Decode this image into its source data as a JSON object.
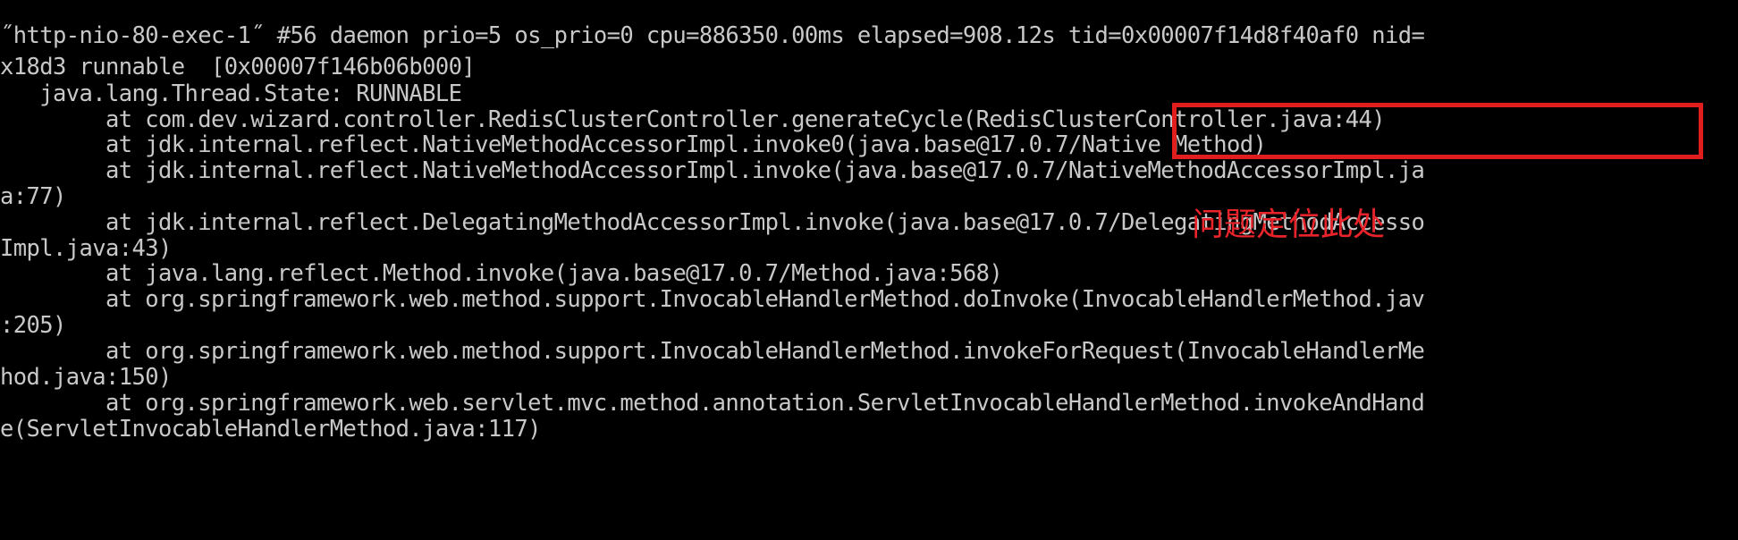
{
  "terminal": {
    "lines": [
      "˝http-nio-80-exec-1˝ #56 daemon prio=5 os_prio=0 cpu=886350.00ms elapsed=908.12s tid=0x00007f14d8f40af0 nid=",
      "x18d3 runnable  [0x00007f146b06b000]",
      "   java.lang.Thread.State: RUNNABLE",
      "        at com.dev.wizard.controller.RedisClusterController.generateCycle(RedisClusterController.java:44)",
      "        at jdk.internal.reflect.NativeMethodAccessorImpl.invoke0(java.base@17.0.7/Native Method)",
      "        at jdk.internal.reflect.NativeMethodAccessorImpl.invoke(java.base@17.0.7/NativeMethodAccessorImpl.ja",
      "a:77)",
      "        at jdk.internal.reflect.DelegatingMethodAccessorImpl.invoke(java.base@17.0.7/DelegatingMethodAccesso",
      "Impl.java:43)",
      "        at java.lang.reflect.Method.invoke(java.base@17.0.7/Method.java:568)",
      "        at org.springframework.web.method.support.InvocableHandlerMethod.doInvoke(InvocableHandlerMethod.jav",
      ":205)",
      "        at org.springframework.web.method.support.InvocableHandlerMethod.invokeForRequest(InvocableHandlerMe",
      "hod.java:150)",
      "        at org.springframework.web.servlet.mvc.method.annotation.ServletInvocableHandlerMethod.invokeAndHand",
      "e(ServletInvocableHandlerMethod.java:117)"
    ]
  },
  "annotation": {
    "text": "问题定位此处",
    "color": "#e01e1e"
  },
  "colors": {
    "background": "#000000",
    "text": "#c8c8c8"
  }
}
